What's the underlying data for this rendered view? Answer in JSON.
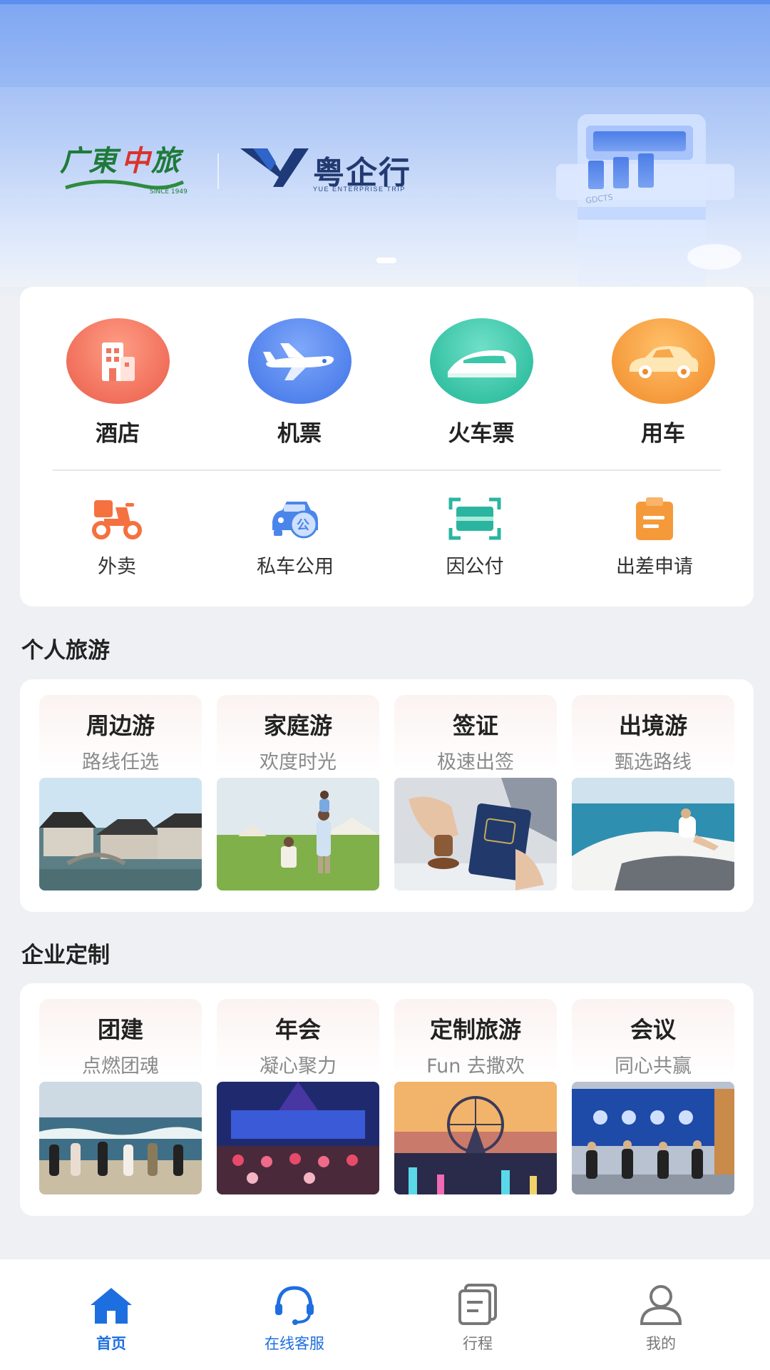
{
  "banner": {
    "logo_left_text": "广东中旅",
    "logo_left_since": "SINCE 1949",
    "logo_right_text": "粤企行",
    "logo_right_sub": "YUE ENTERPRISE TRIP",
    "building_sign": "GDCTS"
  },
  "services": {
    "main": [
      {
        "label": "酒店",
        "icon": "hotel-icon",
        "color": "#f0705c"
      },
      {
        "label": "机票",
        "icon": "airplane-icon",
        "color": "#4d82ee"
      },
      {
        "label": "火车票",
        "icon": "train-icon",
        "color": "#2dc3a6"
      },
      {
        "label": "用车",
        "icon": "car-icon",
        "color": "#f59a3a"
      }
    ],
    "secondary": [
      {
        "label": "外卖",
        "icon": "scooter-icon"
      },
      {
        "label": "私车公用",
        "icon": "private-car-icon"
      },
      {
        "label": "因公付",
        "icon": "scan-pay-icon"
      },
      {
        "label": "出差申请",
        "icon": "clipboard-icon"
      }
    ]
  },
  "personal_travel": {
    "title": "个人旅游",
    "items": [
      {
        "title": "周边游",
        "subtitle": "路线任选"
      },
      {
        "title": "家庭游",
        "subtitle": "欢度时光"
      },
      {
        "title": "签证",
        "subtitle": "极速出签"
      },
      {
        "title": "出境游",
        "subtitle": "甄选路线"
      }
    ]
  },
  "enterprise": {
    "title": "企业定制",
    "items": [
      {
        "title": "团建",
        "subtitle": "点燃团魂"
      },
      {
        "title": "年会",
        "subtitle": "凝心聚力"
      },
      {
        "title": "定制旅游",
        "subtitle": "Fun 去撒欢"
      },
      {
        "title": "会议",
        "subtitle": "同心共赢"
      }
    ]
  },
  "bottom_nav": [
    {
      "label": "首页",
      "icon": "home-icon",
      "active": true
    },
    {
      "label": "在线客服",
      "icon": "headset-icon",
      "active": false
    },
    {
      "label": "行程",
      "icon": "itinerary-icon",
      "active": false
    },
    {
      "label": "我的",
      "icon": "profile-icon",
      "active": false
    }
  ],
  "colors": {
    "accent": "#1d6fe0",
    "secondary_icon_orange": "#f26b3a",
    "secondary_icon_blue": "#3f7fe6",
    "secondary_icon_teal": "#2bb5a0"
  }
}
